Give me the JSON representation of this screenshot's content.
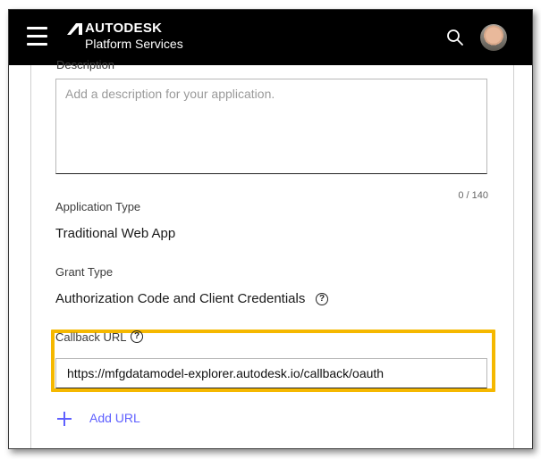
{
  "header": {
    "brand_name": "AUTODESK",
    "product_name": "Platform Services",
    "icons": [
      "menu-icon",
      "search-icon",
      "avatar"
    ]
  },
  "form": {
    "description_label": "Description",
    "description_placeholder": "Add a description for your application.",
    "description_counter": "0 / 140",
    "app_type_label": "Application Type",
    "app_type_value": "Traditional Web App",
    "grant_type_label": "Grant Type",
    "grant_type_value": "Authorization Code and Client Credentials",
    "callback_label": "Callback URL",
    "callback_value": "https://mfgdatamodel-explorer.autodesk.io/callback/oauth",
    "add_url_label": "Add URL",
    "help_glyph": "?"
  },
  "colors": {
    "highlight": "#f5b800",
    "link": "#5f60ff",
    "topbar": "#000000"
  }
}
